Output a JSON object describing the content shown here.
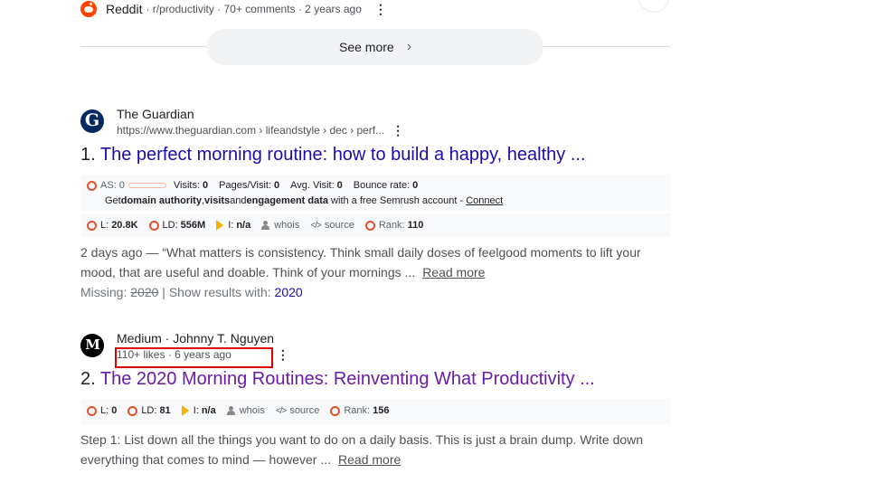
{
  "top_result": {
    "site": "Reddit",
    "meta": "· r/productivity · 70+ comments · 2 years ago",
    "more_icon": "kebab-icon"
  },
  "see_more": {
    "label": "See more",
    "icon": "chevron-right-icon"
  },
  "results": [
    {
      "index": "1.",
      "site_name": "The Guardian",
      "url": "https://www.theguardian.com › lifeandstyle › dec › perf...",
      "logo_letter": "G",
      "title": "The perfect morning routine: how to build a happy, healthy ...",
      "seo_top": {
        "as_label": "AS:",
        "as_value": "0",
        "visits_label": "Visits:",
        "visits_value": "0",
        "ppv_label": "Pages/Visit:",
        "ppv_value": "0",
        "avg_label": "Avg. Visit:",
        "avg_value": "0",
        "bounce_label": "Bounce rate:",
        "bounce_value": "0",
        "promo_pre": "Get ",
        "promo_b1": "domain authority",
        "promo_mid1": ", ",
        "promo_b2": "visits",
        "promo_mid2": " and ",
        "promo_b3": "engagement data",
        "promo_post": " with a free Semrush account - ",
        "connect": "Connect"
      },
      "seo": {
        "l_label": "L:",
        "l_value": "20.8K",
        "ld_label": "LD:",
        "ld_value": "556M",
        "i_label": "I:",
        "i_value": "n/a",
        "whois": "whois",
        "source": "source",
        "rank_label": "Rank:",
        "rank_value": "110"
      },
      "snippet_line1": "2 days ago — “What matters is consistency. Think small daily doses of feelgood moments to lift your",
      "snippet_line2": "mood, that are useful and doable. Think of your mornings ...",
      "read_more": "Read more",
      "missing_label": "Missing:",
      "missing_term": "2020",
      "show_with": "| Show results with:",
      "show_term": "2020"
    },
    {
      "index": "2.",
      "site_name": "Medium · Johnny T. Nguyen",
      "meta": "110+ likes · 6 years ago",
      "logo_letter": "M",
      "title": "The 2020 Morning Routines: Reinventing What Productivity ...",
      "seo": {
        "l_label": "L:",
        "l_value": "0",
        "ld_label": "LD:",
        "ld_value": "81",
        "i_label": "I:",
        "i_value": "n/a",
        "whois": "whois",
        "source": "source",
        "rank_label": "Rank:",
        "rank_value": "156"
      },
      "snippet_line1": "Step 1: List down all the things you want to do on a daily basis. This is just a brain dump. Write down",
      "snippet_line2": "everything that comes to mind — however ...",
      "read_more": "Read more"
    }
  ]
}
